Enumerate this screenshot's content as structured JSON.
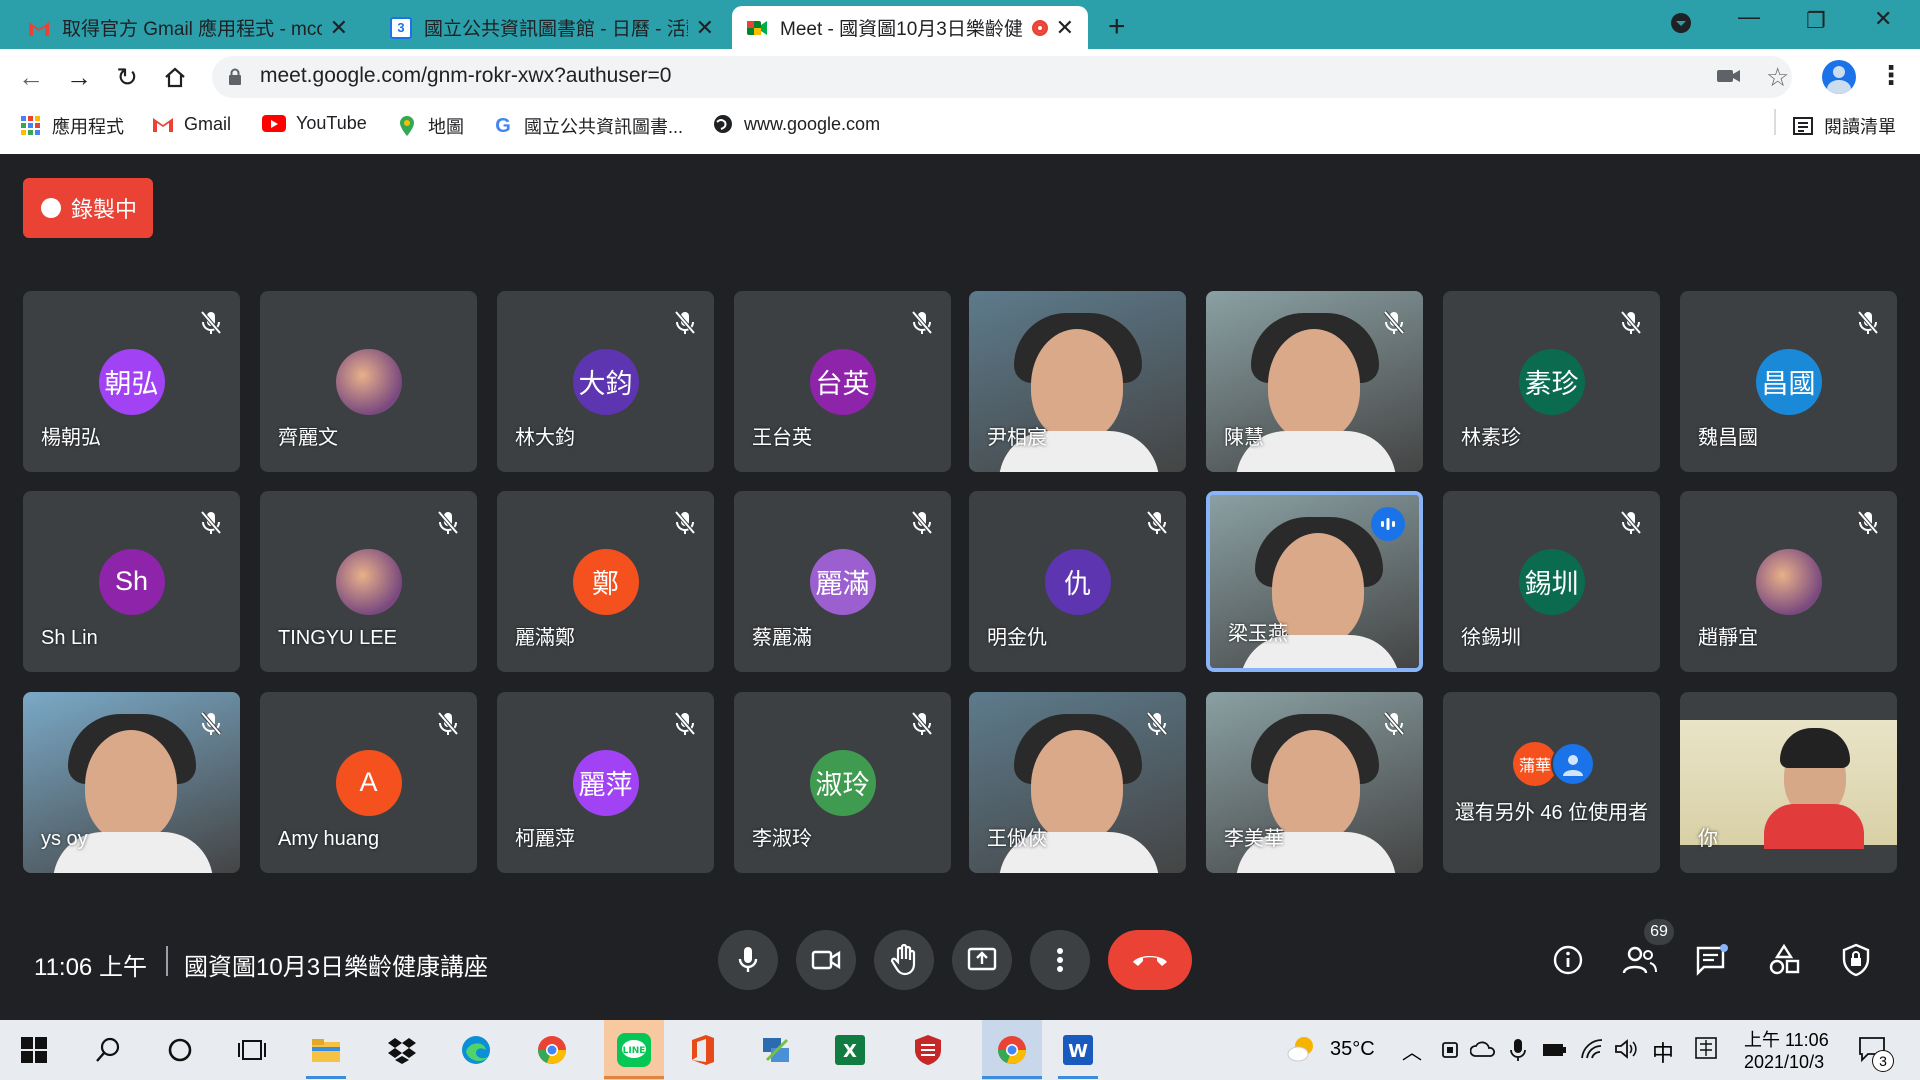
{
  "browser": {
    "tabs": [
      {
        "label": "取得官方 Gmail 應用程式 - mcc(",
        "icon": "gmail-icon"
      },
      {
        "label": "國立公共資訊圖書館 - 日曆 - 活動",
        "icon": "calendar-icon",
        "icon_text": "3"
      },
      {
        "label": "Meet - 國資圖10月3日樂齡健",
        "icon": "meet-icon",
        "active": true
      }
    ],
    "url": "meet.google.com/gnm-rokr-xwx?authuser=0",
    "bookmarks": [
      {
        "label": "應用程式",
        "icon": "apps-grid-icon"
      },
      {
        "label": "Gmail",
        "icon": "gmail-icon"
      },
      {
        "label": "YouTube",
        "icon": "youtube-icon"
      },
      {
        "label": "地圖",
        "icon": "maps-icon"
      },
      {
        "label": "國立公共資訊圖書...",
        "icon": "google-icon"
      },
      {
        "label": "www.google.com",
        "icon": "globe-icon"
      }
    ],
    "reading_list": "閱讀清單"
  },
  "meet": {
    "recording_label": "錄製中",
    "tiles": [
      {
        "name": "楊朝弘",
        "initials": "朝弘",
        "color": "#a142f4",
        "muted": true
      },
      {
        "name": "齊麗文",
        "photo": true,
        "muted": false
      },
      {
        "name": "林大鈞",
        "initials": "大鈞",
        "color": "#5e35b1",
        "muted": true
      },
      {
        "name": "王台英",
        "initials": "台英",
        "color": "#8e24aa",
        "muted": true
      },
      {
        "name": "尹相宸",
        "video": true,
        "muted": false
      },
      {
        "name": "陳慧",
        "video": true,
        "muted": true
      },
      {
        "name": "林素珍",
        "initials": "素珍",
        "color": "#0b6b4f",
        "muted": true
      },
      {
        "name": "魏昌國",
        "initials": "昌國",
        "color": "#1a8ad8",
        "muted": true
      },
      {
        "name": "Sh Lin",
        "initials": "Sh",
        "color": "#8e24aa",
        "muted": true
      },
      {
        "name": "TINGYU LEE",
        "photo": true,
        "muted": true
      },
      {
        "name": "麗滿鄭",
        "initials": "鄭",
        "color": "#f4511e",
        "muted": true
      },
      {
        "name": "蔡麗滿",
        "initials": "麗滿",
        "color": "#9c5fd0",
        "muted": true
      },
      {
        "name": "明金仇",
        "initials": "仇",
        "color": "#5e35b1",
        "muted": true
      },
      {
        "name": "梁玉燕",
        "video": true,
        "speaking": true,
        "muted": false
      },
      {
        "name": "徐錫圳",
        "initials": "錫圳",
        "color": "#0b6b4f",
        "muted": true
      },
      {
        "name": "趙靜宜",
        "photo": true,
        "muted": true
      },
      {
        "name": "ys oy",
        "video": true,
        "muted": true
      },
      {
        "name": "Amy huang",
        "initials": "A",
        "color": "#f4511e",
        "muted": true
      },
      {
        "name": "柯麗萍",
        "initials": "麗萍",
        "color": "#a142f4",
        "muted": true
      },
      {
        "name": "李淑玲",
        "initials": "淑玲",
        "color": "#3f9b4f",
        "muted": true
      },
      {
        "name": "王俶俠",
        "video": true,
        "muted": true
      },
      {
        "name": "李美華",
        "video": true,
        "muted": true
      },
      {
        "name": "還有另外 46 位使用者",
        "more": true,
        "more_initial": "蒲華"
      },
      {
        "name": "你",
        "video": true,
        "self": true
      }
    ],
    "time": "11:06 上午",
    "title": "國資圖10月3日樂齡健康講座",
    "participant_count": "69"
  },
  "taskbar": {
    "weather": "35°C",
    "ime": "中",
    "clock_time": "上午 11:06",
    "clock_date": "2021/10/3",
    "notifications": "3"
  }
}
